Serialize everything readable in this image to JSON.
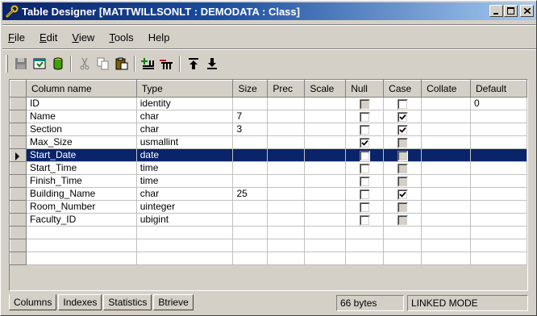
{
  "window": {
    "title": "Table Designer  [MATTWILLSONLT : DEMODATA : Class]",
    "minimize_label": "_",
    "maximize_label": "□",
    "close_label": "✕"
  },
  "menu": {
    "items": [
      {
        "label": "File",
        "accel": "F",
        "rest": "ile"
      },
      {
        "label": "Edit",
        "accel": "E",
        "rest": "dit"
      },
      {
        "label": "View",
        "accel": "V",
        "rest": "iew"
      },
      {
        "label": "Tools",
        "accel": "T",
        "rest": "ools"
      },
      {
        "label": "Help",
        "accel": "",
        "rest": "Help"
      }
    ]
  },
  "toolbar": {
    "icons": [
      "save-icon",
      "compile-icon",
      "database-icon",
      "cut-icon",
      "copy-icon",
      "paste-icon",
      "insert-column-icon",
      "delete-column-icon",
      "move-top-icon",
      "move-bottom-icon"
    ]
  },
  "grid": {
    "columns": [
      "Column name",
      "Type",
      "Size",
      "Prec",
      "Scale",
      "Null",
      "Case",
      "Collate",
      "Default"
    ],
    "rows": [
      {
        "name": "ID",
        "type": "identity",
        "size": "",
        "prec": "",
        "scale": "",
        "null": "disabled",
        "case": "unchecked",
        "collate": "",
        "default": "0"
      },
      {
        "name": "Name",
        "type": "char",
        "size": "7",
        "prec": "",
        "scale": "",
        "null": "unchecked",
        "case": "checked",
        "collate": "",
        "default": ""
      },
      {
        "name": "Section",
        "type": "char",
        "size": "3",
        "prec": "",
        "scale": "",
        "null": "unchecked",
        "case": "checked",
        "collate": "",
        "default": ""
      },
      {
        "name": "Max_Size",
        "type": "usmallint",
        "size": "",
        "prec": "",
        "scale": "",
        "null": "checked",
        "case": "disabled",
        "collate": "",
        "default": ""
      },
      {
        "name": "Start_Date",
        "type": "date",
        "size": "",
        "prec": "",
        "scale": "",
        "null": "unchecked",
        "case": "disabled",
        "collate": "",
        "default": "",
        "selected": true
      },
      {
        "name": "Start_Time",
        "type": "time",
        "size": "",
        "prec": "",
        "scale": "",
        "null": "unchecked",
        "case": "disabled",
        "collate": "",
        "default": ""
      },
      {
        "name": "Finish_Time",
        "type": "time",
        "size": "",
        "prec": "",
        "scale": "",
        "null": "unchecked",
        "case": "disabled",
        "collate": "",
        "default": ""
      },
      {
        "name": "Building_Name",
        "type": "char",
        "size": "25",
        "prec": "",
        "scale": "",
        "null": "unchecked",
        "case": "checked",
        "collate": "",
        "default": ""
      },
      {
        "name": "Room_Number",
        "type": "uinteger",
        "size": "",
        "prec": "",
        "scale": "",
        "null": "unchecked",
        "case": "disabled",
        "collate": "",
        "default": ""
      },
      {
        "name": "Faculty_ID",
        "type": "ubigint",
        "size": "",
        "prec": "",
        "scale": "",
        "null": "unchecked",
        "case": "disabled",
        "collate": "",
        "default": ""
      }
    ]
  },
  "tabs": [
    "Columns",
    "Indexes",
    "Statistics",
    "Btrieve"
  ],
  "status": {
    "size": "66 bytes",
    "mode": "LINKED MODE"
  },
  "colors": {
    "title_start": "#0a246a",
    "title_end": "#a6caf0",
    "selection": "#0a246a",
    "face": "#d4d0c8"
  }
}
